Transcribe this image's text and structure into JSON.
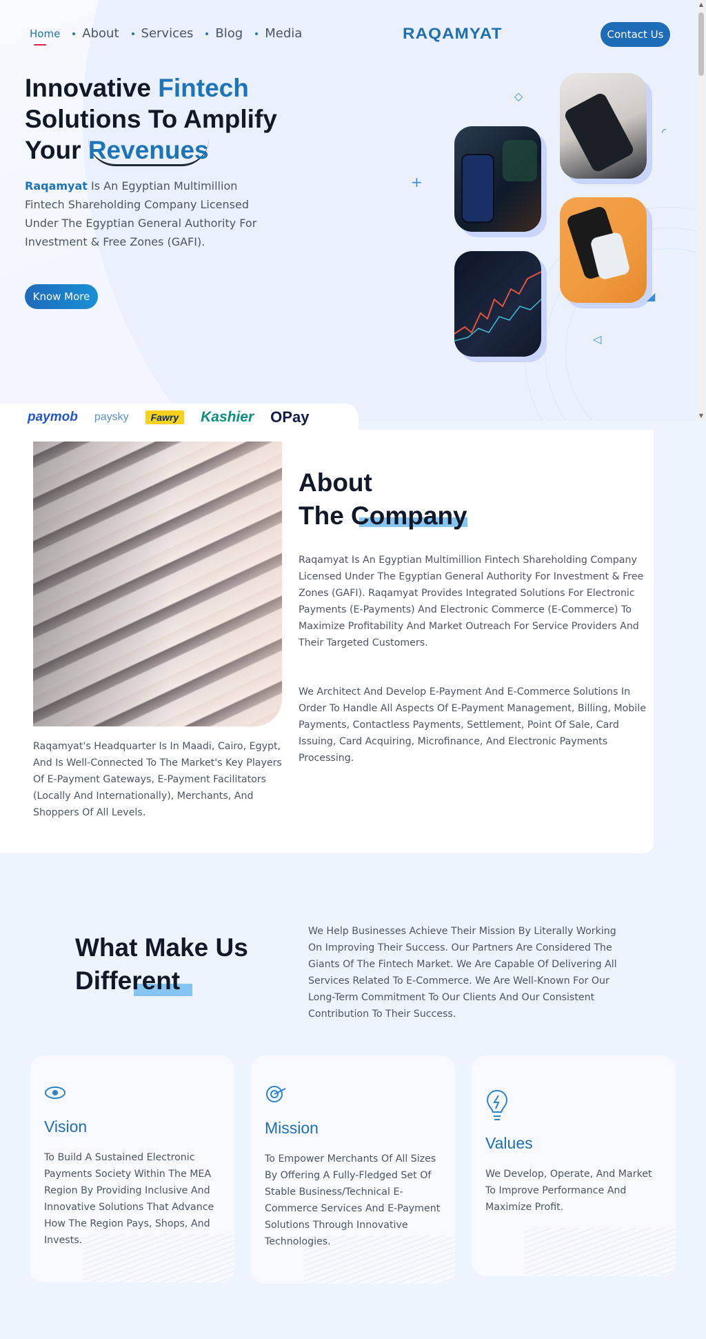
{
  "nav": {
    "items": [
      {
        "label": "Home",
        "active": true
      },
      {
        "label": "About",
        "active": false
      },
      {
        "label": "Services",
        "active": false
      },
      {
        "label": "Blog",
        "active": false
      },
      {
        "label": "Media",
        "active": false
      }
    ],
    "logo": "RAQAMYAT",
    "contact_label": "Contact Us"
  },
  "hero": {
    "title_part1": "Innovative ",
    "title_highlight": "Fintech",
    "title_part2": "Solutions To Amplify",
    "title_part3": "Your ",
    "title_underlined": "Revenues",
    "brand": "Raqamyat",
    "description": " Is An Egyptian Multimillion Fintech Shareholding Company Licensed Under The Egyptian General Authority For Investment & Free Zones (GAFI).",
    "button_label": "Know More"
  },
  "partners": [
    "paymob",
    "paysky",
    "Fawry",
    "Kashier",
    "OPay"
  ],
  "about": {
    "title_line1": "About",
    "title_line2": "The Company",
    "paragraph1": "Raqamyat Is An Egyptian Multimillion Fintech Shareholding Company Licensed Under The Egyptian General Authority For Investment & Free Zones (GAFI). Raqamyat Provides Integrated Solutions For Electronic Payments (E-Payments) And Electronic Commerce (E-Commerce) To Maximize Profitability And Market Outreach For Service Providers And Their Targeted Customers.",
    "paragraph2": "We Architect And Develop E-Payment And E-Commerce Solutions In Order To Handle All Aspects Of E-Payment Management, Billing, Mobile Payments, Contactless Payments, Settlement, Point Of Sale, Card Issuing, Card Acquiring, Microfinance, And Electronic Payments Processing.",
    "paragraph3": "Raqamyat's Headquarter Is In Maadi, Cairo, Egypt, And Is Well-Connected To The Market's Key Players Of E-Payment Gateways, E-Payment Facilitators (Locally And Internationally), Merchants, And Shoppers Of All Levels."
  },
  "difference": {
    "title_line1": "What Make Us",
    "title_line2": "Different",
    "description": "We Help Businesses Achieve Their Mission By Literally Working On Improving Their Success. Our Partners Are Considered The Giants Of The Fintech Market. We Are Capable Of Delivering All Services Related To E-Commerce. We Are Well-Known For Our Long-Term Commitment To Our Clients And Our Consistent Contribution To Their Success."
  },
  "cards": [
    {
      "icon": "eye-icon",
      "title": "Vision",
      "text": "To Build A Sustained Electronic Payments Society Within The MEA Region By Providing Inclusive And Innovative Solutions That Advance How The Region Pays, Shops, And Invests."
    },
    {
      "icon": "target-icon",
      "title": "Mission",
      "text": "To Empower Merchants Of All Sizes By Offering A Fully-Fledged Set Of Stable Business/Technical E-Commerce Services And E-Payment Solutions Through Innovative Technologies."
    },
    {
      "icon": "lightbulb-icon",
      "title": "Values",
      "text": "We Develop, Operate, And Market To Improve Performance And Maximize Profit."
    }
  ],
  "colors": {
    "primary": "#1d74b8",
    "button": "#1e6bb8",
    "highlight": "#86c5f2",
    "page_bg": "#eef4fe"
  }
}
